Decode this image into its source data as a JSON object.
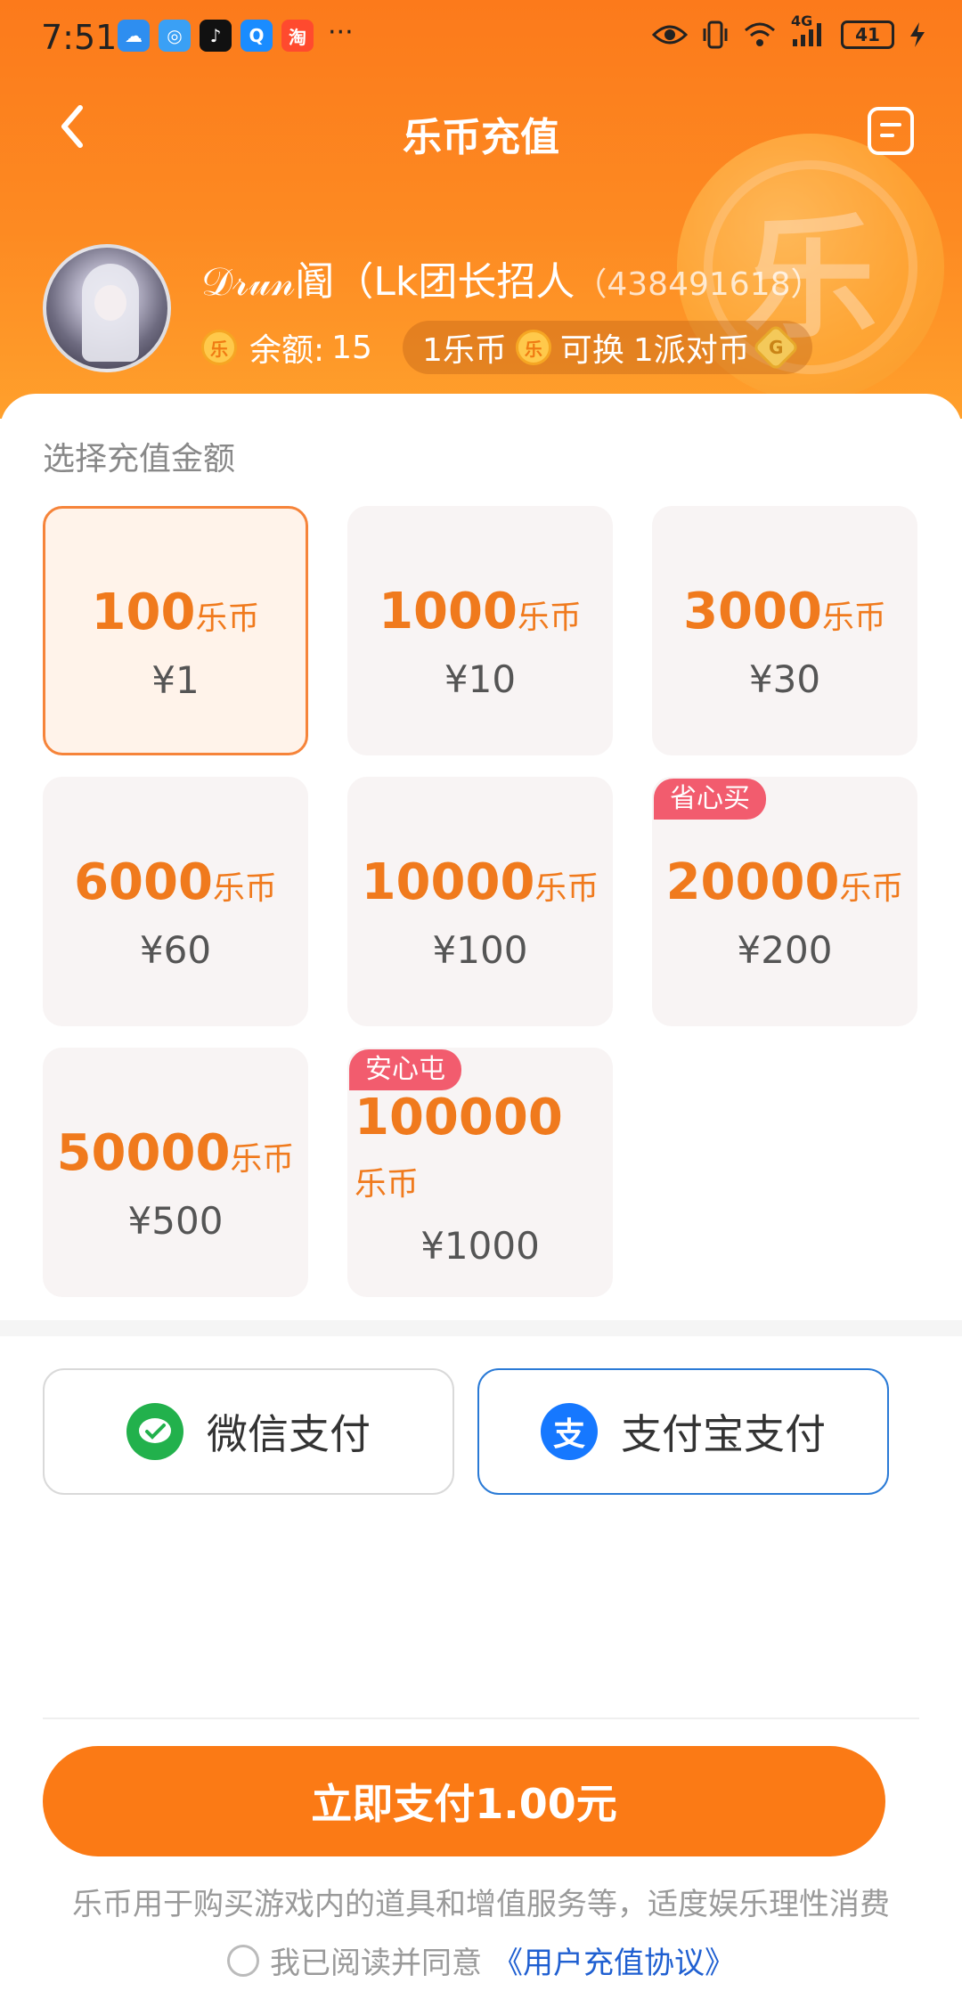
{
  "status_bar": {
    "time": "7:51",
    "more": "···",
    "network": "4G",
    "battery": "41",
    "app_icons": [
      "weather-app",
      "browser-app",
      "tiktok-app",
      "search-app",
      "taobao-app"
    ]
  },
  "nav": {
    "title": "乐币充值"
  },
  "profile": {
    "name": "𝒟𝓇𝓊𝓃阍（Lk团长招人",
    "uid": "（438491618）",
    "balance_label": "余额:",
    "balance_value": "15",
    "rate_left": "1乐币",
    "rate_middle": "可换",
    "rate_right": "1派对币"
  },
  "recharge": {
    "section_title": "选择充值金额",
    "unit": "乐币",
    "packages": [
      {
        "amount": "100",
        "price": "¥1",
        "selected": true,
        "tag": ""
      },
      {
        "amount": "1000",
        "price": "¥10",
        "selected": false,
        "tag": ""
      },
      {
        "amount": "3000",
        "price": "¥30",
        "selected": false,
        "tag": ""
      },
      {
        "amount": "6000",
        "price": "¥60",
        "selected": false,
        "tag": ""
      },
      {
        "amount": "10000",
        "price": "¥100",
        "selected": false,
        "tag": ""
      },
      {
        "amount": "20000",
        "price": "¥200",
        "selected": false,
        "tag": "省心买"
      },
      {
        "amount": "50000",
        "price": "¥500",
        "selected": false,
        "tag": ""
      },
      {
        "amount": "100000",
        "price": "¥1000",
        "selected": false,
        "tag": "安心屯"
      }
    ]
  },
  "payment": {
    "wechat_label": "微信支付",
    "alipay_label": "支付宝支付",
    "selected": "alipay"
  },
  "footer": {
    "pay_button": "立即支付1.00元",
    "disclaimer": "乐币用于购买游戏内的道具和增值服务等，适度娱乐理性消费",
    "agree_text": "我已阅读并同意",
    "agree_link": "《用户充值协议》"
  },
  "colors": {
    "brand_orange": "#fb7a15",
    "price_orange": "#f07a1d",
    "tag_pink": "#f25c6e",
    "link_blue": "#1f5fd1",
    "wechat_green": "#22b14c",
    "alipay_blue": "#1678ff"
  }
}
